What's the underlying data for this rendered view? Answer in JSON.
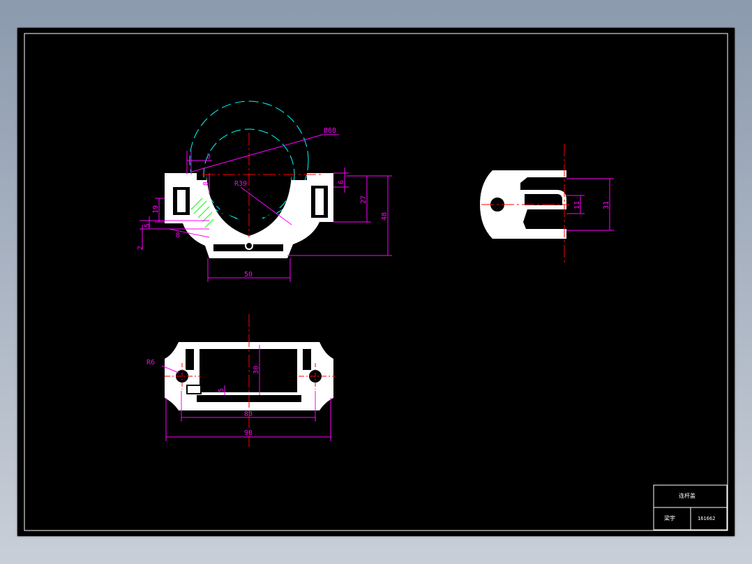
{
  "title_block": {
    "name": "连杆盖",
    "designer_label": "梁宇",
    "drawing_no": "161662"
  },
  "dimensions": {
    "d68": "Ø68",
    "r39": "R39",
    "d3": "3",
    "d8": "8",
    "d6": "6",
    "d27": "27",
    "d48": "48",
    "d19": "19",
    "d5": "5",
    "d8b": "8",
    "d2": "2",
    "d50": "50",
    "d11": "11",
    "d31": "31",
    "r6": "R6",
    "d30": "30",
    "d5b": "5",
    "d80": "80",
    "d98": "98"
  },
  "colors": {
    "sheet": "#000000",
    "outline": "#ffffff",
    "dimension": "#ff00ff",
    "centerline": "#ff0000",
    "phantom": "#00ffff",
    "hatch": "#00ff00"
  }
}
